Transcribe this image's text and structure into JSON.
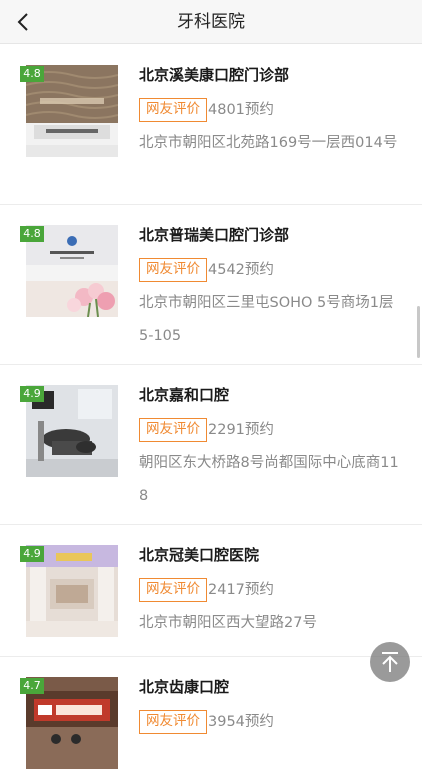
{
  "header": {
    "title": "牙科医院"
  },
  "clinics": [
    {
      "rating": "4.8",
      "name": "北京溪美康口腔门诊部",
      "tag": "网友评价",
      "bookings": "4801预约",
      "address": "北京市朝阳区北苑路169号一层西014号"
    },
    {
      "rating": "4.8",
      "name": "北京普瑞美口腔门诊部",
      "tag": "网友评价",
      "bookings": "4542预约",
      "address": "北京市朝阳区三里屯SOHO 5号商场1层5-105"
    },
    {
      "rating": "4.9",
      "name": "北京嘉和口腔",
      "tag": "网友评价",
      "bookings": "2291预约",
      "address": "朝阳区东大桥路8号尚都国际中心底商118"
    },
    {
      "rating": "4.9",
      "name": "北京冠美口腔医院",
      "tag": "网友评价",
      "bookings": "2417预约",
      "address": "北京市朝阳区西大望路27号"
    },
    {
      "rating": "4.7",
      "name": "北京齿康口腔",
      "tag": "网友评价",
      "bookings": "3954预约",
      "address": ""
    }
  ],
  "icons": {
    "back": "chevron-left-icon",
    "scroll_top": "arrow-up-to-top-icon"
  },
  "colors": {
    "tag": "#f08a32",
    "rating_badge": "#4aa63a"
  }
}
